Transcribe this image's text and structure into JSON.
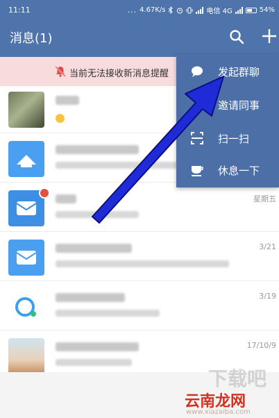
{
  "status_bar": {
    "time": "11:11",
    "dots": "...",
    "speed": "4.67K/s",
    "carrier": "电信 4G",
    "battery": "54%"
  },
  "header": {
    "title": "消息(1)"
  },
  "notice": {
    "text": "当前无法接收新消息提醒"
  },
  "menu": {
    "items": [
      {
        "label": "发起群聊",
        "icon": "chat-bubble-icon"
      },
      {
        "label": "邀请同事",
        "icon": "invite-icon"
      },
      {
        "label": "扫一扫",
        "icon": "scan-icon"
      },
      {
        "label": "休息一下",
        "icon": "coffee-cup-icon"
      }
    ]
  },
  "chats": [
    {
      "time": ""
    },
    {
      "time": ""
    },
    {
      "time": "星期五"
    },
    {
      "time": "3/21"
    },
    {
      "time": "3/19"
    },
    {
      "time": "17/10/9"
    }
  ],
  "watermark": {
    "top": "下载吧",
    "brand": "云南龙网",
    "url": "www.xiazaiba.com"
  },
  "colors": {
    "header": "#4f74ab",
    "menu": "#4b6fa6",
    "notice_bg": "#f8dcdd",
    "arrow": "#1f2bd6"
  }
}
